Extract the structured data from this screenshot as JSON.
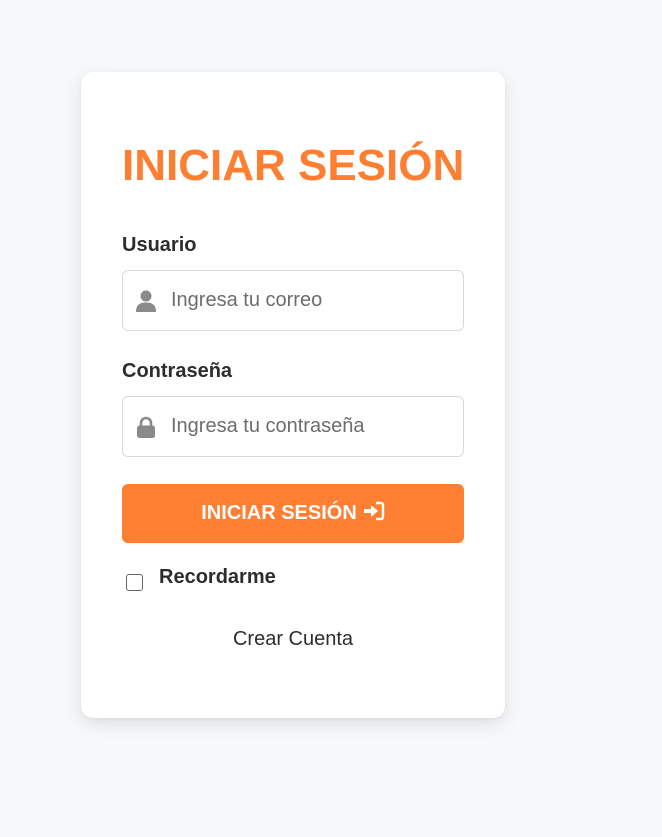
{
  "login": {
    "title": "INICIAR SESIÓN",
    "user_label": "Usuario",
    "user_placeholder": "Ingresa tu correo",
    "pass_label": "Contraseña",
    "pass_placeholder": "Ingresa tu contraseña",
    "submit_label": "INICIAR SESIÓN",
    "remember_label": "Recordarme",
    "remember_checked": false,
    "create_account_label": "Crear Cuenta"
  },
  "icons": {
    "user": "user-icon",
    "password": "lock-icon",
    "submit": "sign-in-icon"
  },
  "colors": {
    "accent": "#ff7f32",
    "background": "#f7f8fa",
    "card": "#ffffff",
    "text": "#2d2d2d",
    "icon": "#8a8a8a"
  }
}
